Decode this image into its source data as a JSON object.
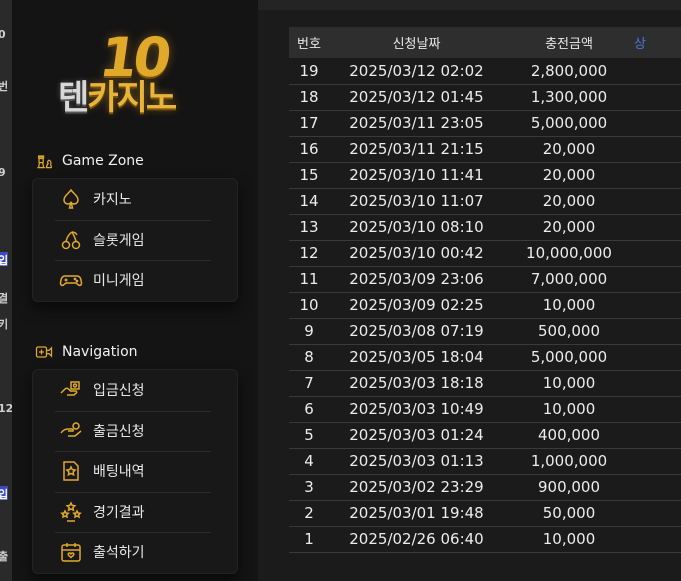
{
  "background": {
    "fragments": [
      "0",
      "번",
      "9",
      "입",
      "결",
      "키",
      "12",
      "입",
      "출"
    ]
  },
  "logo": {
    "number": "10",
    "word_part1": "텐",
    "word_part2": "카지노"
  },
  "game_zone": {
    "title": "Game Zone",
    "items": [
      {
        "label": "카지노",
        "icon": "spade-icon"
      },
      {
        "label": "슬롯게임",
        "icon": "cherry-icon"
      },
      {
        "label": "미니게임",
        "icon": "gamepad-icon"
      }
    ]
  },
  "navigation": {
    "title": "Navigation",
    "items": [
      {
        "label": "입금신청",
        "icon": "deposit-icon"
      },
      {
        "label": "출금신청",
        "icon": "withdraw-icon"
      },
      {
        "label": "배팅내역",
        "icon": "star-doc-icon"
      },
      {
        "label": "경기결과",
        "icon": "stars-icon"
      },
      {
        "label": "출석하기",
        "icon": "calendar-icon"
      }
    ]
  },
  "table": {
    "headers": [
      "번호",
      "신청날짜",
      "충전금액",
      "상"
    ],
    "rows": [
      {
        "no": "19",
        "date": "2025/03/12 02:02",
        "amount": "2,800,000"
      },
      {
        "no": "18",
        "date": "2025/03/12 01:45",
        "amount": "1,300,000"
      },
      {
        "no": "17",
        "date": "2025/03/11 23:05",
        "amount": "5,000,000"
      },
      {
        "no": "16",
        "date": "2025/03/11 21:15",
        "amount": "20,000"
      },
      {
        "no": "15",
        "date": "2025/03/10 11:41",
        "amount": "20,000"
      },
      {
        "no": "14",
        "date": "2025/03/10 11:07",
        "amount": "20,000"
      },
      {
        "no": "13",
        "date": "2025/03/10 08:10",
        "amount": "20,000"
      },
      {
        "no": "12",
        "date": "2025/03/10 00:42",
        "amount": "10,000,000"
      },
      {
        "no": "11",
        "date": "2025/03/09 23:06",
        "amount": "7,000,000"
      },
      {
        "no": "10",
        "date": "2025/03/09 02:25",
        "amount": "10,000"
      },
      {
        "no": "9",
        "date": "2025/03/08 07:19",
        "amount": "500,000"
      },
      {
        "no": "8",
        "date": "2025/03/05 18:04",
        "amount": "5,000,000"
      },
      {
        "no": "7",
        "date": "2025/03/03 18:18",
        "amount": "10,000"
      },
      {
        "no": "6",
        "date": "2025/03/03 10:49",
        "amount": "10,000"
      },
      {
        "no": "5",
        "date": "2025/03/03 01:24",
        "amount": "400,000"
      },
      {
        "no": "4",
        "date": "2025/03/03 01:13",
        "amount": "1,000,000"
      },
      {
        "no": "3",
        "date": "2025/03/02 23:29",
        "amount": "900,000"
      },
      {
        "no": "2",
        "date": "2025/03/01 19:48",
        "amount": "50,000"
      },
      {
        "no": "1",
        "date": "2025/02/26 06:40",
        "amount": "10,000"
      }
    ]
  },
  "colors": {
    "accent_gold": "#e1a92a",
    "sidebar_bg": "#141414",
    "table_header_bg": "#2e2e2e"
  }
}
